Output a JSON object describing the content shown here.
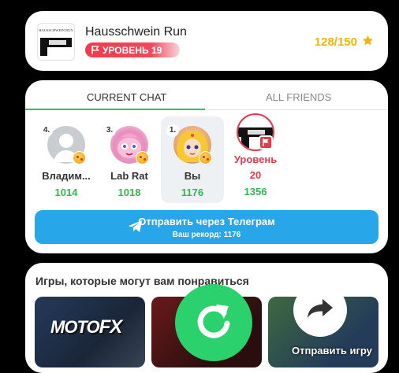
{
  "game": {
    "title": "Hausschwein Run",
    "thumb_text": "HAUSSCHWEIN RUN",
    "level_label": "УРОВЕНЬ 19",
    "progress": "128/150",
    "accent_color": "#f0b40a",
    "level_color": "#ef3b4e"
  },
  "tabs": {
    "current": "CURRENT CHAT",
    "all": "ALL FRIENDS"
  },
  "leaderboard": [
    {
      "rank": "4.",
      "name": "Владим...",
      "score": "1014"
    },
    {
      "rank": "3.",
      "name": "Lab Rat",
      "score": "1018"
    },
    {
      "rank": "1.",
      "name": "Вы",
      "score": "1176"
    }
  ],
  "level_slot": {
    "name": "Уровень",
    "level": "20",
    "score": "1356"
  },
  "telegram": {
    "label": "Отправить через Телеграм",
    "record": "Ваш рекорд: 1176",
    "color": "#27a6ea"
  },
  "suggestions": {
    "title": "Игры, которые могут вам понравиться",
    "tile1_logo_a": "MOTO",
    "tile1_logo_b": "FX"
  },
  "actions": {
    "share_label": "Отправить игру",
    "restart_color": "#2bd16d"
  }
}
